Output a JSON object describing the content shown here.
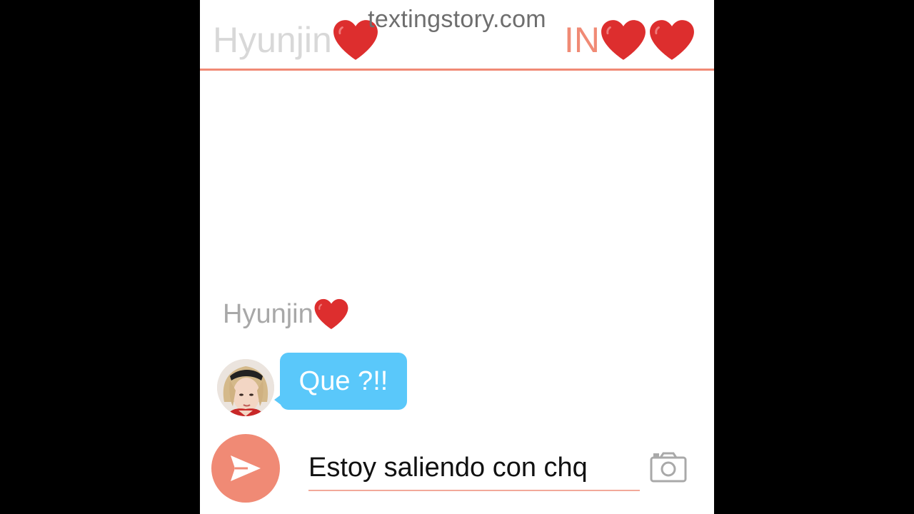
{
  "watermark": "textingstory.com",
  "header": {
    "contact_name": "Hyunjin",
    "title": "IN",
    "heart_icon": "red-heart-icon",
    "accent_color": "#f08a75"
  },
  "conversation": {
    "messages": [
      {
        "sender": "Hyunjin",
        "text": "Que ?!!",
        "bubble_color": "#5ac8fa"
      }
    ]
  },
  "composer": {
    "value": "Estoy saliendo con chq",
    "send_icon": "send-icon",
    "camera_icon": "camera-icon"
  }
}
